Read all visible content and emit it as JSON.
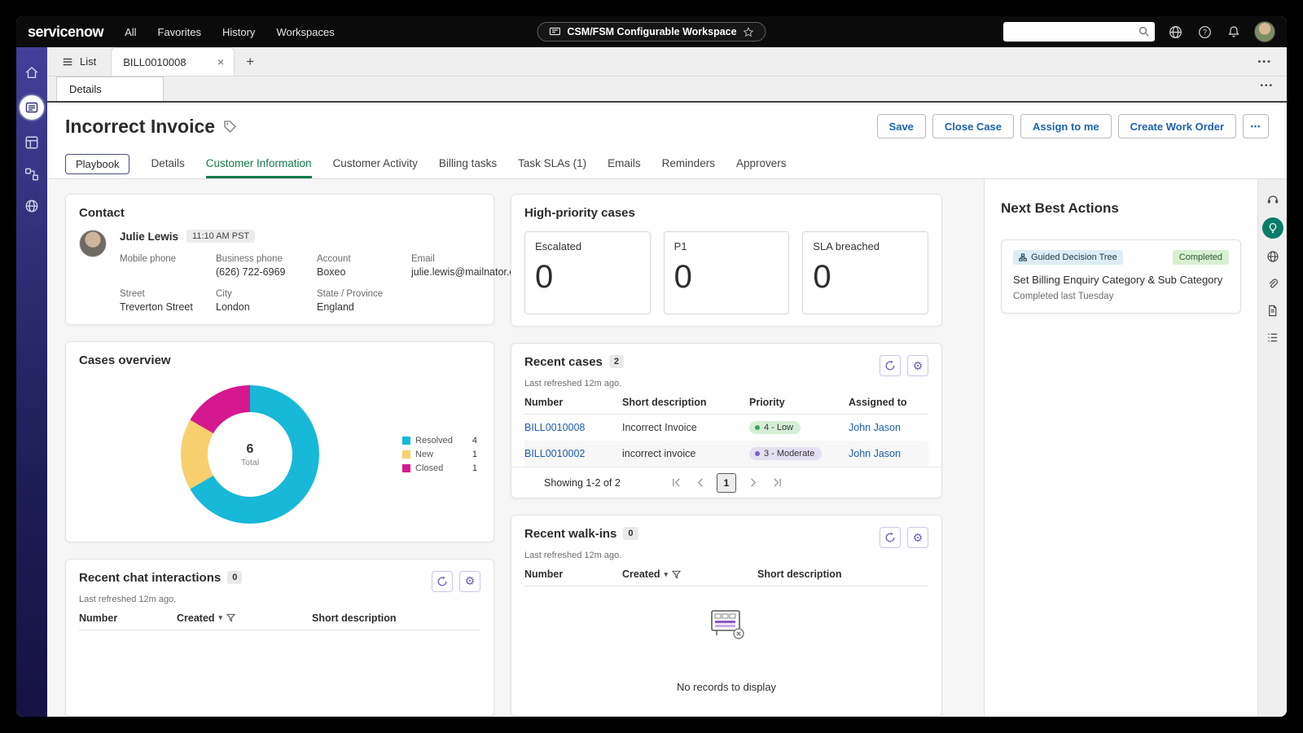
{
  "colors": {
    "accent_green": "#127a4c",
    "link_blue": "#1a5cb0",
    "sidebar_indigo": "#30307a",
    "priority_low_bg": "#d5efd5",
    "priority_moderate_bg": "#e4e0f2"
  },
  "header": {
    "logo": "servicenow",
    "nav": [
      "All",
      "Favorites",
      "History",
      "Workspaces"
    ],
    "workspace_pill": "CSM/FSM Configurable Workspace"
  },
  "tab_bar": {
    "list_label": "List",
    "record_tab_label": "BILL0010008",
    "close_glyph": "×",
    "add_glyph": "+",
    "more_glyph": "•••"
  },
  "sub_tab_label": "Details",
  "record": {
    "title": "Incorrect Invoice",
    "actions": {
      "save": "Save",
      "close_case": "Close Case",
      "assign_to_me": "Assign to me",
      "create_work_order": "Create Work Order",
      "more_glyph": "•••"
    },
    "tabs": [
      "Playbook",
      "Details",
      "Customer Information",
      "Customer Activity",
      "Billing tasks",
      "Task SLAs (1)",
      "Emails",
      "Reminders",
      "Approvers"
    ],
    "active_tab": "Customer Information"
  },
  "contact": {
    "title": "Contact",
    "name": "Julie Lewis",
    "time_badge": "11:10 AM PST",
    "fields": [
      {
        "label": "Mobile phone",
        "value": ""
      },
      {
        "label": "Business phone",
        "value": "(626) 722-6969"
      },
      {
        "label": "Account",
        "value": "Boxeo"
      },
      {
        "label": "Email",
        "value": "julie.lewis@mailnator.c..."
      },
      {
        "label": "Street",
        "value": "Treverton Street"
      },
      {
        "label": "City",
        "value": "London"
      },
      {
        "label": "State / Province",
        "value": "England"
      }
    ]
  },
  "high_priority": {
    "title": "High-priority cases",
    "metrics": [
      {
        "label": "Escalated",
        "value": "0"
      },
      {
        "label": "P1",
        "value": "0"
      },
      {
        "label": "SLA breached",
        "value": "0"
      }
    ]
  },
  "cases_overview": {
    "title": "Cases overview"
  },
  "chart_data": {
    "type": "pie",
    "title": "Cases overview",
    "center_value": "6",
    "center_label": "Total",
    "segments": [
      {
        "label": "Resolved",
        "value": 4,
        "color": "#17b8d8"
      },
      {
        "label": "New",
        "value": 1,
        "color": "#f7cf6e"
      },
      {
        "label": "Closed",
        "value": 1,
        "color": "#d6188f"
      }
    ],
    "legend_position": "right"
  },
  "recent_cases": {
    "title": "Recent cases",
    "count": "2",
    "refreshed": "Last refreshed 12m ago.",
    "headers": [
      "Number",
      "Short description",
      "Priority",
      "Assigned to"
    ],
    "rows": [
      {
        "number": "BILL0010008",
        "short_description": "Incorrect Invoice",
        "priority": "4 - Low",
        "assigned_to": "John Jason"
      },
      {
        "number": "BILL0010002",
        "short_description": "incorrect invoice",
        "priority": "3 - Moderate",
        "assigned_to": "John Jason"
      }
    ],
    "footer": {
      "showing": "Showing 1-2 of 2",
      "page": "1"
    }
  },
  "recent_walkins": {
    "title": "Recent walk-ins",
    "count": "0",
    "refreshed": "Last refreshed 12m ago.",
    "headers": [
      "Number",
      "Created",
      "Short description"
    ],
    "empty_text": "No records to display"
  },
  "recent_chats": {
    "title": "Recent chat interactions",
    "count": "0",
    "refreshed": "Last refreshed 12m ago.",
    "headers": [
      "Number",
      "Created",
      "Short description"
    ]
  },
  "next_best_actions": {
    "title": "Next Best Actions",
    "card": {
      "badge": "Guided Decision Tree",
      "status": "Completed",
      "text": "Set Billing Enquiry Category & Sub Category",
      "subtext": "Completed last Tuesday"
    }
  }
}
